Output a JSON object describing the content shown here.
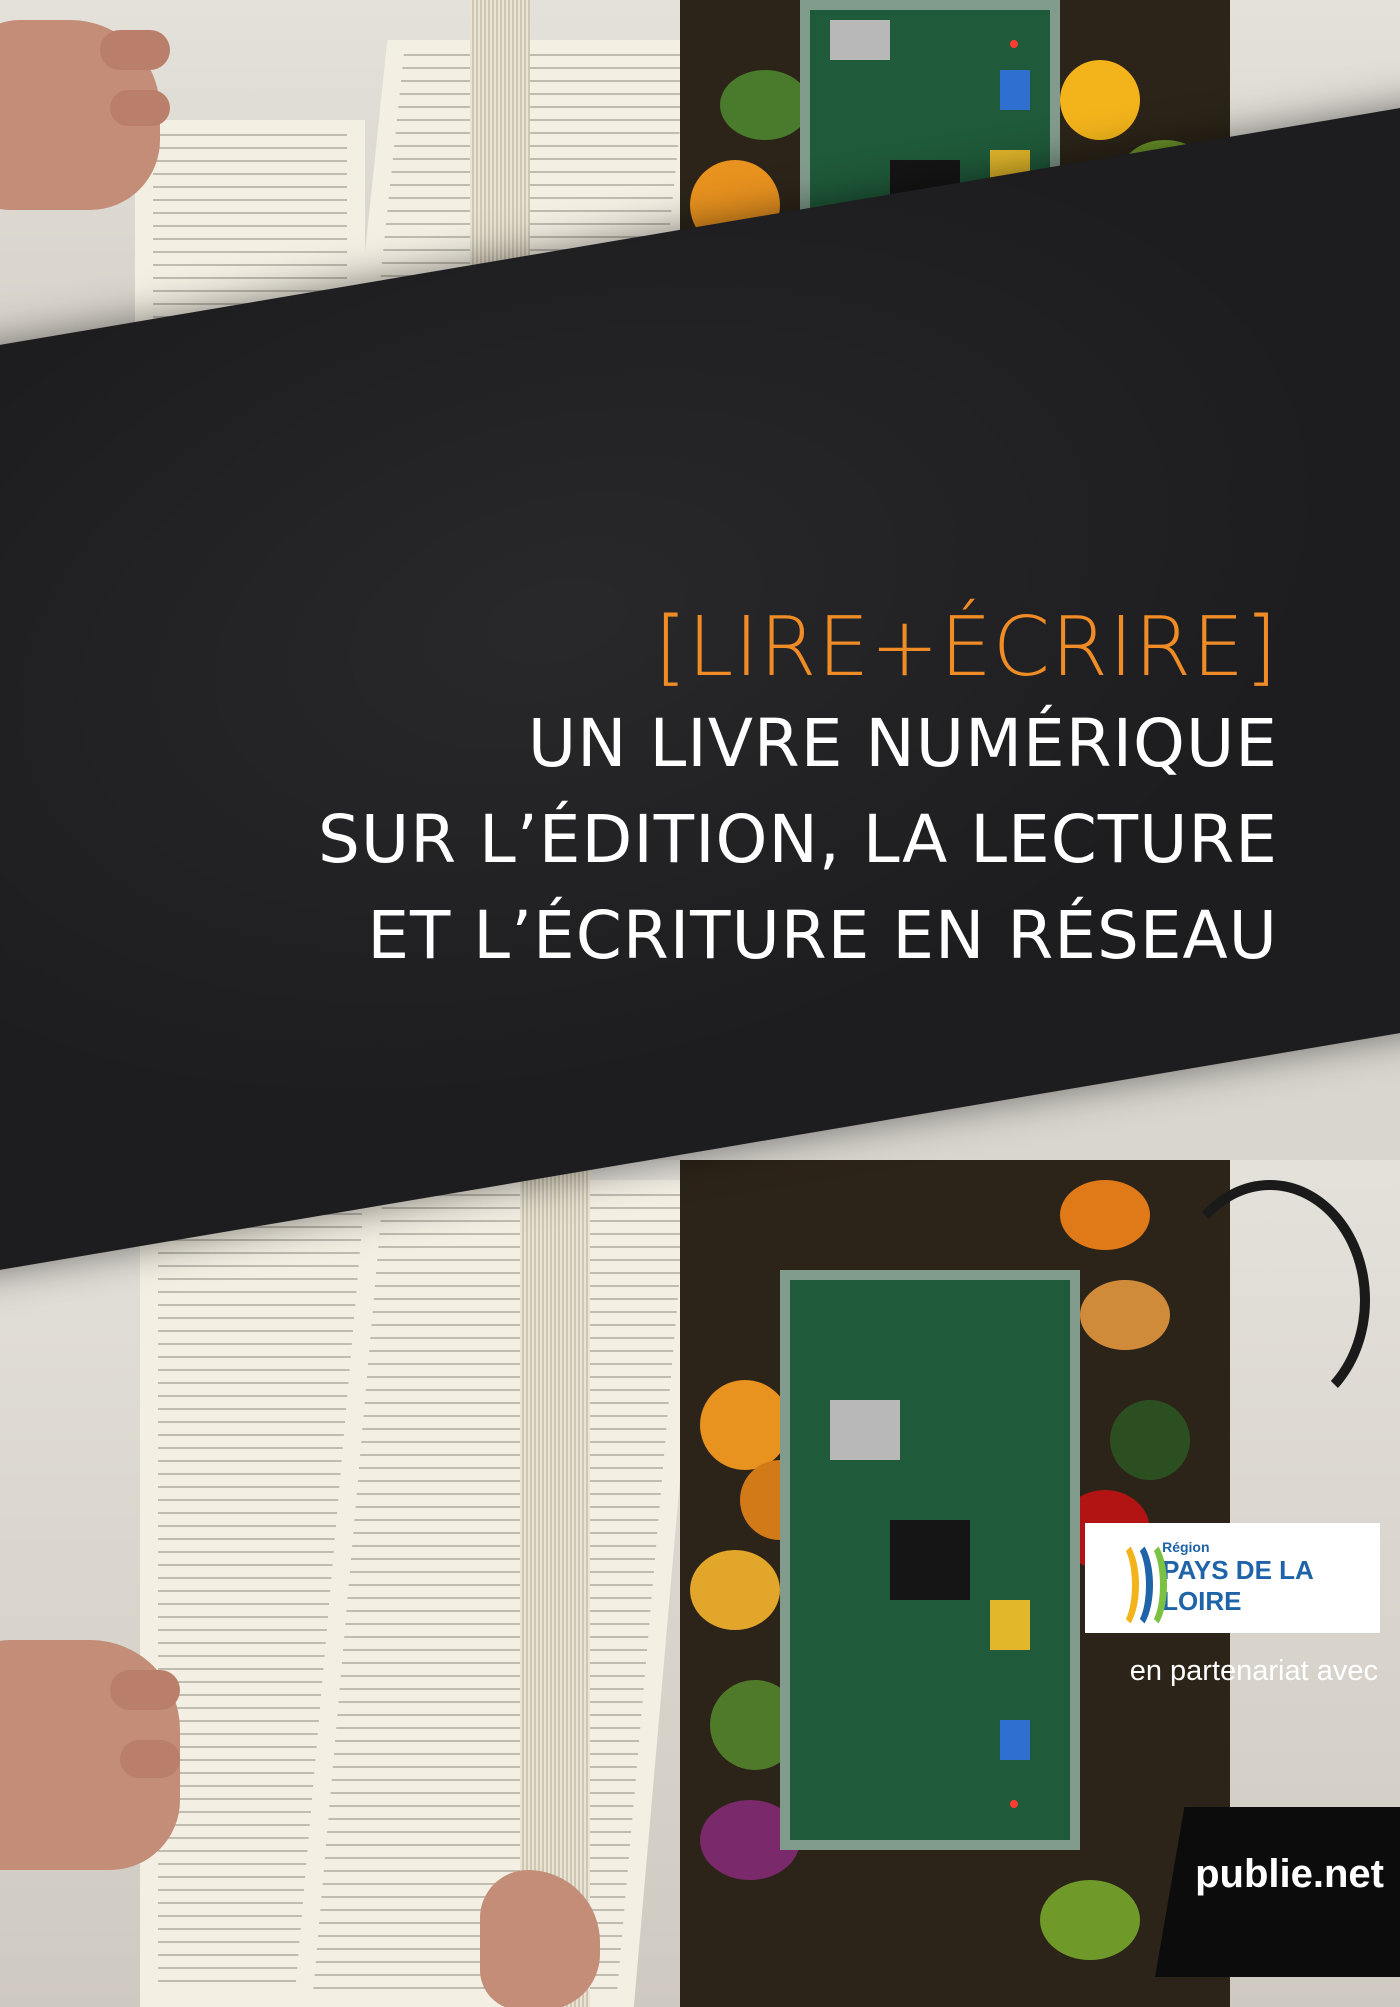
{
  "cover": {
    "title": "[LIRE+ÉCRIRE]",
    "subtitle_lines": [
      "UN LIVRE NUMÉRIQUE",
      "SUR L’ÉDITION, LA LECTURE",
      "ET L’ÉCRITURE EN RÉSEAU"
    ]
  },
  "colors": {
    "band": "#1d1d20",
    "title_accent": "#f08c25",
    "subtitle": "#ffffff",
    "region_blue": "#1f63a8"
  },
  "logos": {
    "region": {
      "small": "Région",
      "name": "PAYS DE LA LOIRE"
    },
    "partner_text": "en partenariat avec",
    "publisher": "publie.net"
  }
}
